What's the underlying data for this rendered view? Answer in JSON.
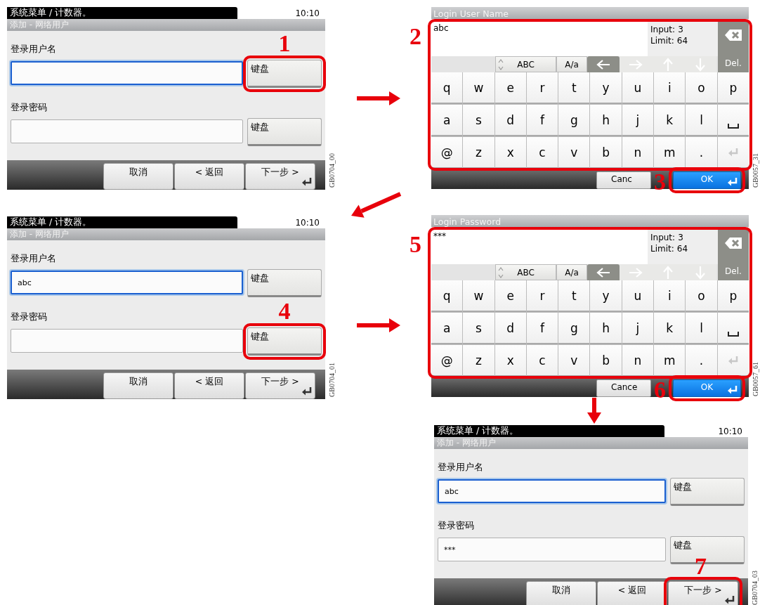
{
  "screens": [
    {
      "kind": "form",
      "path": "系统菜单 / 计数器。",
      "time": "10:10",
      "title": "添加 - 网络用户",
      "fields": [
        {
          "label": "登录用户名",
          "focused": true,
          "button": "键盘",
          "callout": "1"
        },
        {
          "label": "登录密码",
          "focused": false,
          "button": "键盘"
        }
      ],
      "buttons": [
        {
          "label": "取消",
          "enter": false
        },
        {
          "label": "< 返回",
          "enter": false
        },
        {
          "label": "下一步 >",
          "enter": true
        }
      ],
      "figure_id": "GB0704_00"
    },
    {
      "kind": "keyboard",
      "title": "Login User Name",
      "text": "abc",
      "input_label": "Input:",
      "input_count": "3",
      "limit_label": "Limit:",
      "limit_count": "64",
      "del_label": "Del.",
      "modes": [
        "ABC",
        "A/a"
      ],
      "nav": [
        {
          "kind": "left",
          "disabled": false
        },
        {
          "kind": "right",
          "disabled": true
        },
        {
          "kind": "up",
          "disabled": true
        },
        {
          "kind": "down",
          "disabled": true
        }
      ],
      "rows": [
        [
          "q",
          "w",
          "e",
          "r",
          "t",
          "y",
          "u",
          "i",
          "o",
          "p"
        ],
        [
          "a",
          "s",
          "d",
          "f",
          "g",
          "h",
          "j",
          "k",
          "l",
          {
            "kind": "space"
          }
        ],
        [
          "@",
          "z",
          "x",
          "c",
          "v",
          "b",
          "n",
          "m",
          ".",
          {
            "kind": "enter"
          }
        ]
      ],
      "cancel": "Canc",
      "ok": "OK",
      "keys_callout": "2",
      "ok_callout": "3",
      "figure_id": "GB0057_31"
    },
    {
      "kind": "form",
      "path": "系统菜单 / 计数器。",
      "time": "10:10",
      "title": "添加 - 网络用户",
      "fields": [
        {
          "label": "登录用户名",
          "value": "abc",
          "focused": true,
          "button": "键盘"
        },
        {
          "label": "登录密码",
          "focused": false,
          "button": "键盘",
          "callout": "4"
        }
      ],
      "buttons": [
        {
          "label": "取消",
          "enter": false
        },
        {
          "label": "< 返回",
          "enter": false
        },
        {
          "label": "下一步 >",
          "enter": true
        }
      ],
      "figure_id": "GB0704_01"
    },
    {
      "kind": "keyboard",
      "title": "Login Password",
      "text": "***",
      "input_label": "Input:",
      "input_count": "3",
      "limit_label": "Limit:",
      "limit_count": "64",
      "del_label": "Del.",
      "modes": [
        "ABC",
        "A/a"
      ],
      "nav": [
        {
          "kind": "left",
          "disabled": false
        },
        {
          "kind": "right",
          "disabled": true
        },
        {
          "kind": "up",
          "disabled": true
        },
        {
          "kind": "down",
          "disabled": true
        }
      ],
      "rows": [
        [
          "q",
          "w",
          "e",
          "r",
          "t",
          "y",
          "u",
          "i",
          "o",
          "p"
        ],
        [
          "a",
          "s",
          "d",
          "f",
          "g",
          "h",
          "j",
          "k",
          "l",
          {
            "kind": "space"
          }
        ],
        [
          "@",
          "z",
          "x",
          "c",
          "v",
          "b",
          "n",
          "m",
          ".",
          {
            "kind": "enter"
          }
        ]
      ],
      "cancel": "Cance",
      "ok": "OK",
      "keys_callout": "5",
      "ok_callout": "6",
      "figure_id": "GB0057_61"
    },
    {
      "kind": "form",
      "path": "系统菜单 / 计数器。",
      "time": "10:10",
      "title": "添加 - 网络用户",
      "fields": [
        {
          "label": "登录用户名",
          "value": "abc",
          "focused": true,
          "button": "键盘"
        },
        {
          "label": "登录密码",
          "value": "***",
          "focused": false,
          "button": "键盘"
        }
      ],
      "buttons": [
        {
          "label": "取消",
          "enter": false
        },
        {
          "label": "< 返回",
          "enter": false
        },
        {
          "label": "下一步 >",
          "enter": true,
          "callout": "7"
        }
      ],
      "figure_id": "GB0704_03"
    }
  ]
}
